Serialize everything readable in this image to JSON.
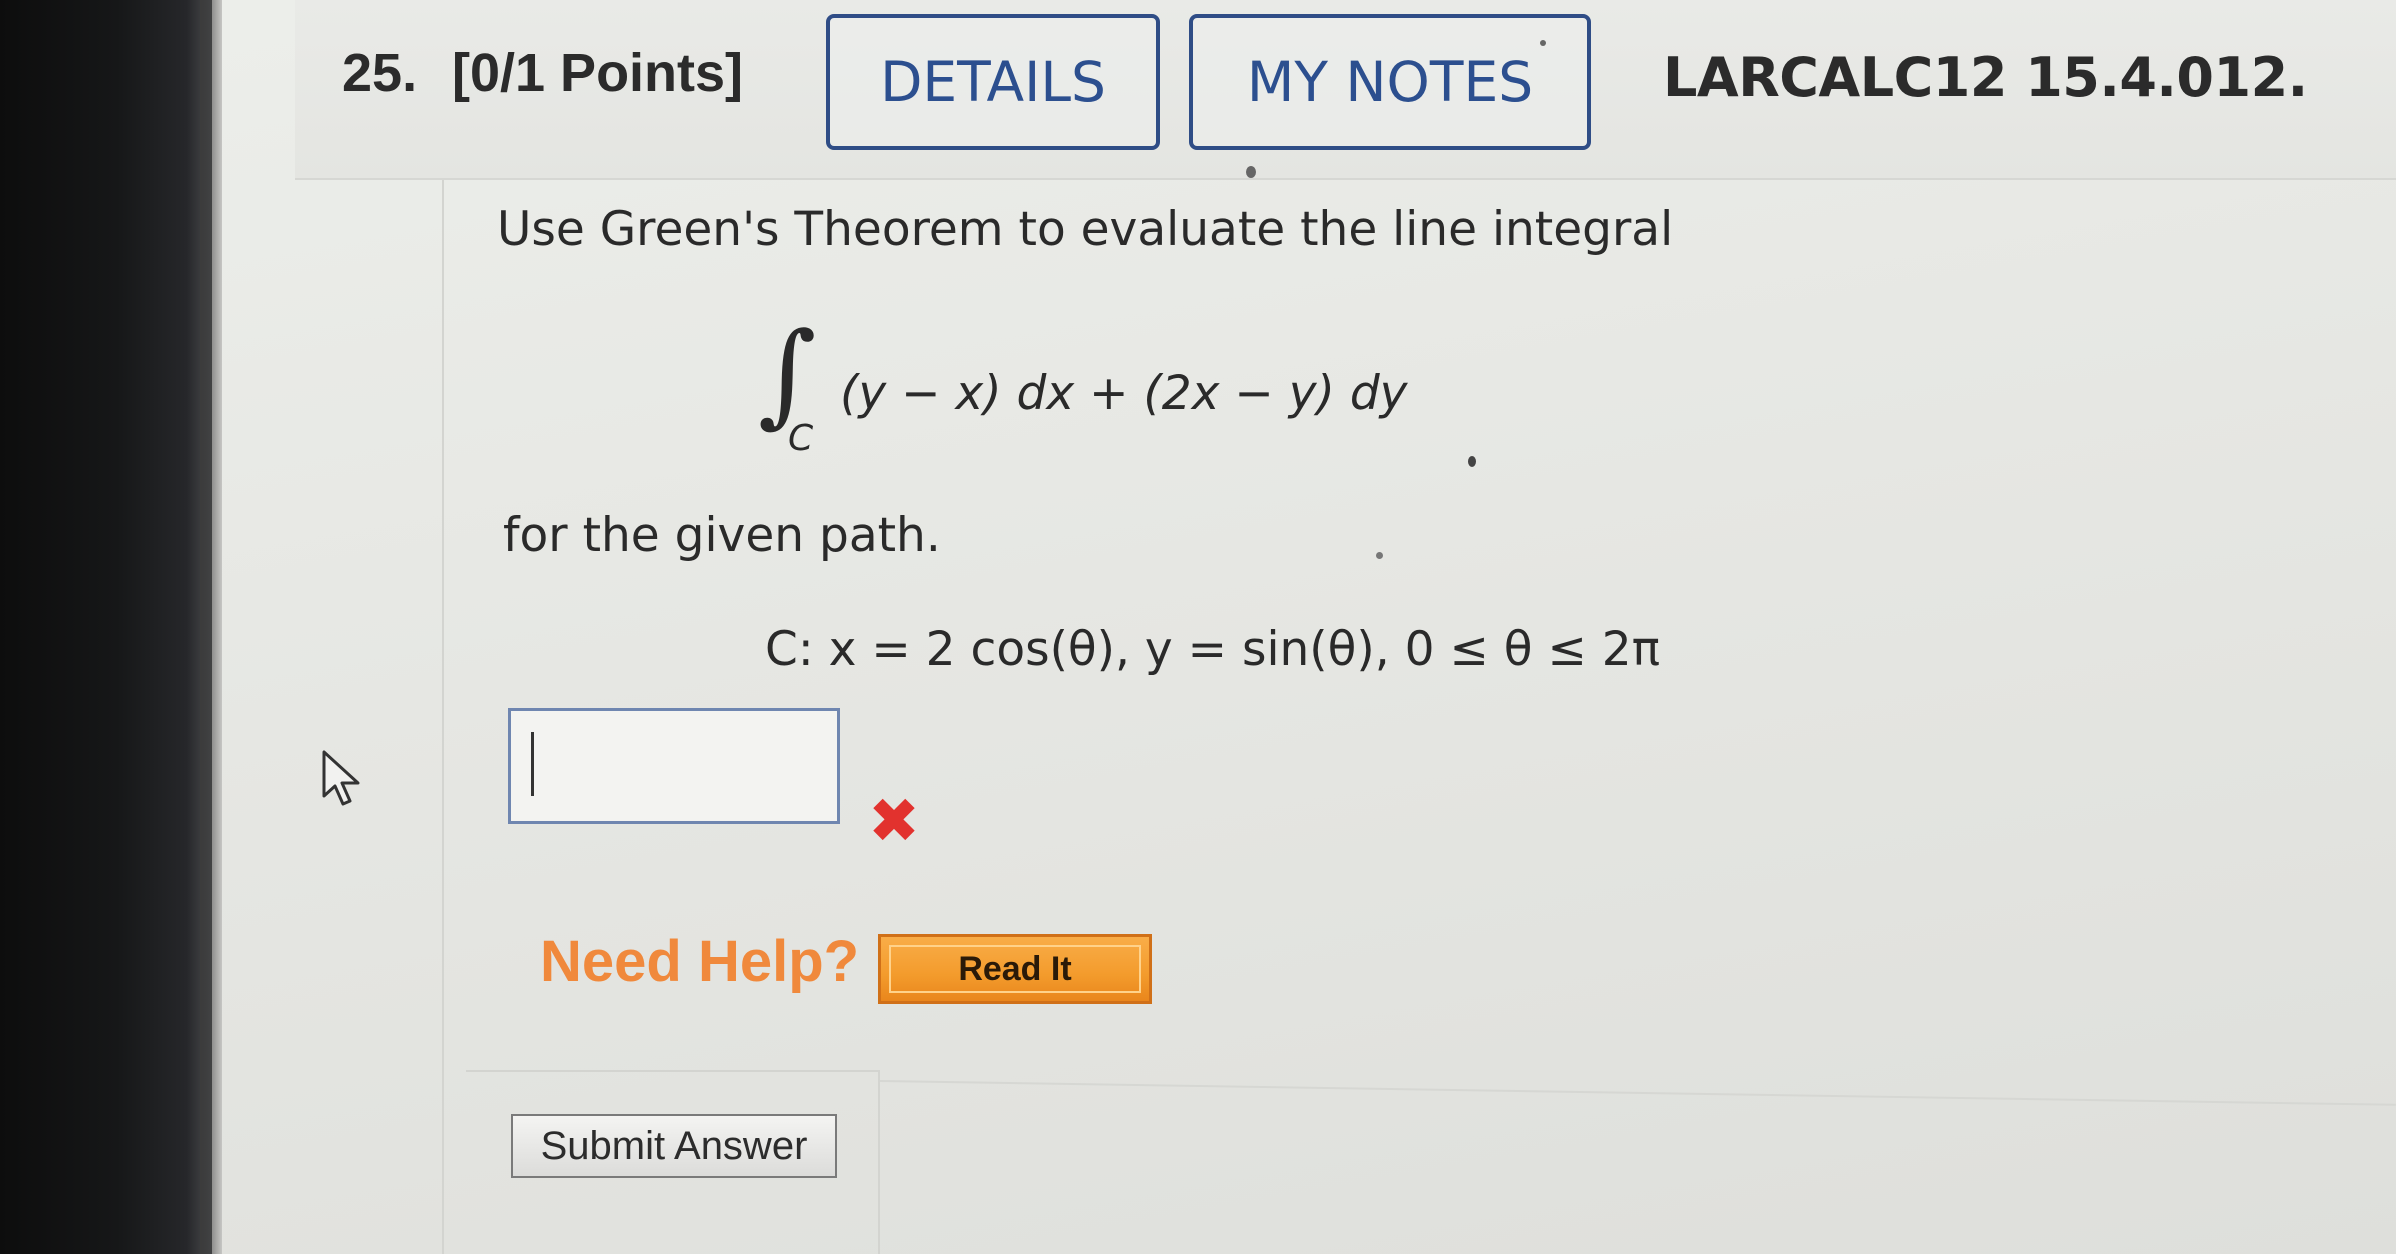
{
  "question": {
    "number": "25.",
    "points": "[0/1 Points]",
    "details_label": "DETAILS",
    "my_notes_label": "MY NOTES",
    "problem_code": "LARCALC12 15.4.012."
  },
  "problem": {
    "prompt": "Use Green's Theorem to evaluate the line integral",
    "integral_symbol": "∫",
    "integral_subscript": "C",
    "integrand": "(y − x) dx + (2x − y) dy",
    "path_intro": "for the given path.",
    "path_definition": "C: x = 2 cos(θ), y = sin(θ), 0 ≤ θ ≤ 2π"
  },
  "answer": {
    "value": "",
    "status": "incorrect",
    "status_icon": "red-x-icon"
  },
  "help": {
    "label": "Need Help?",
    "read_it_label": "Read It"
  },
  "actions": {
    "submit_label": "Submit Answer"
  },
  "colors": {
    "accent_blue": "#2c4f8f",
    "help_orange": "#f0893c",
    "button_orange": "#f39b2c",
    "error_red": "#e2322e"
  }
}
